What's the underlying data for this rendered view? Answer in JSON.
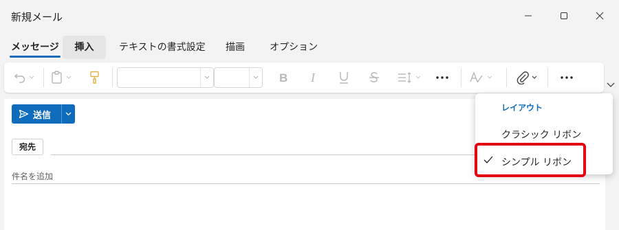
{
  "window": {
    "title": "新規メール"
  },
  "tabs": [
    {
      "label": "メッセージ"
    },
    {
      "label": "挿入"
    },
    {
      "label": "テキストの書式設定"
    },
    {
      "label": "描画"
    },
    {
      "label": "オプション"
    }
  ],
  "compose": {
    "send_label": "送信",
    "to_label": "宛先",
    "subject_placeholder": "件名を追加"
  },
  "layout_menu": {
    "header": "レイアウト",
    "items": [
      {
        "label": "クラシック リボン",
        "checked": false
      },
      {
        "label": "シンプル リボン",
        "checked": true
      }
    ]
  },
  "colors": {
    "accent": "#0f6cbd",
    "highlight_box": "#e3000f"
  }
}
